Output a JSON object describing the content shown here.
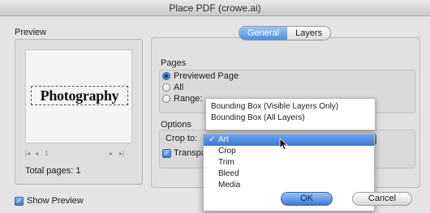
{
  "window": {
    "title": "Place PDF (crowe.ai)"
  },
  "preview": {
    "label": "Preview",
    "canvas_text": "Photography",
    "pager": {
      "first": "|◂",
      "prev": "◂",
      "page": "1",
      "next": "▸",
      "last": "▸|"
    },
    "total_pages": "Total pages: 1",
    "show_preview_label": "Show Preview",
    "show_preview_checked": true
  },
  "tabs": [
    {
      "label": "General",
      "active": true
    },
    {
      "label": "Layers",
      "active": false
    }
  ],
  "pages": {
    "label": "Pages",
    "options": [
      {
        "label": "Previewed Page",
        "selected": true
      },
      {
        "label": "All",
        "selected": false
      },
      {
        "label": "Range:",
        "selected": false
      }
    ]
  },
  "options": {
    "label": "Options",
    "crop_to_label": "Crop to:",
    "transparent_label": "Transparent Background",
    "transparent_checked": true
  },
  "menu_top": [
    "Bounding Box (Visible Layers Only)",
    "Bounding Box (All Layers)"
  ],
  "crop_menu": {
    "items": [
      "Art",
      "Crop",
      "Trim",
      "Bleed",
      "Media"
    ],
    "selected": "Art",
    "checkmark": "✓"
  },
  "buttons": {
    "ok": "OK",
    "cancel": "Cancel"
  },
  "colors": {
    "accent": "#3a7bd5",
    "window_bg": "#e4e4e4"
  }
}
